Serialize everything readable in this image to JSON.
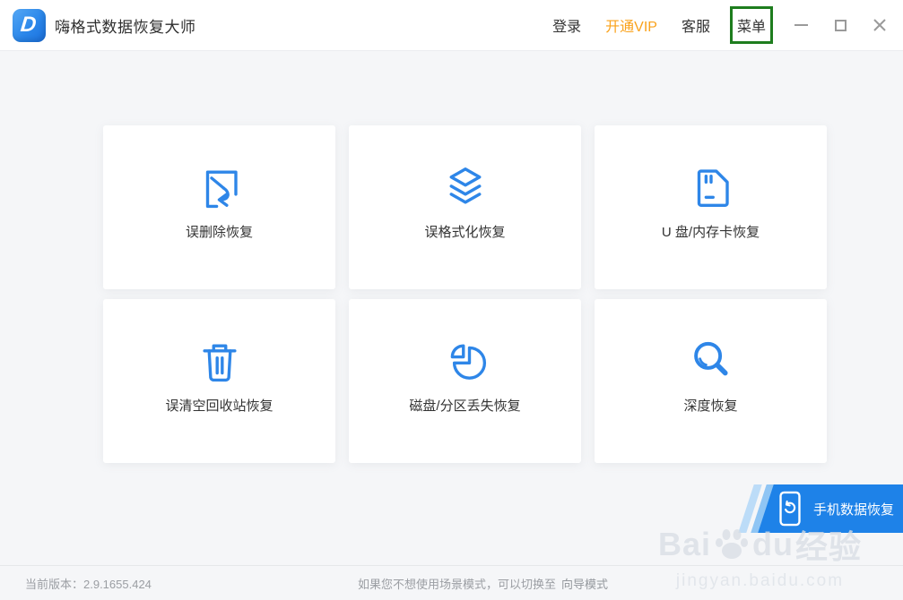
{
  "header": {
    "logo_letter": "D",
    "title": "嗨格式数据恢复大师",
    "nav": {
      "login": "登录",
      "vip": "开通VIP",
      "support": "客服",
      "menu": "菜单"
    }
  },
  "cards": [
    {
      "label": "误删除恢复",
      "icon": "undelete-recovery-icon"
    },
    {
      "label": "误格式化恢复",
      "icon": "format-recovery-icon"
    },
    {
      "label": "U 盘/内存卡恢复",
      "icon": "usb-sdcard-recovery-icon"
    },
    {
      "label": "误清空回收站恢复",
      "icon": "recycle-bin-recovery-icon"
    },
    {
      "label": "磁盘/分区丢失恢复",
      "icon": "disk-partition-recovery-icon"
    },
    {
      "label": "深度恢复",
      "icon": "deep-recovery-icon"
    }
  ],
  "phone_banner": {
    "label": "手机数据恢复",
    "icon": "phone-recovery-icon"
  },
  "watermark": {
    "brand_prefix": "Bai",
    "brand_mid": "du",
    "brand_suffix": "经验",
    "url": "jingyan.baidu.com"
  },
  "footer": {
    "version": "当前版本：2.9.1655.424",
    "hint_text": "如果您不想使用场景模式，可以切换至",
    "hint_link": "向导模式"
  },
  "colors": {
    "accent_blue": "#2e86e8",
    "banner_blue": "#1e82e8",
    "vip_orange": "#faa21b",
    "annotation_green": "#1e7d1e"
  }
}
